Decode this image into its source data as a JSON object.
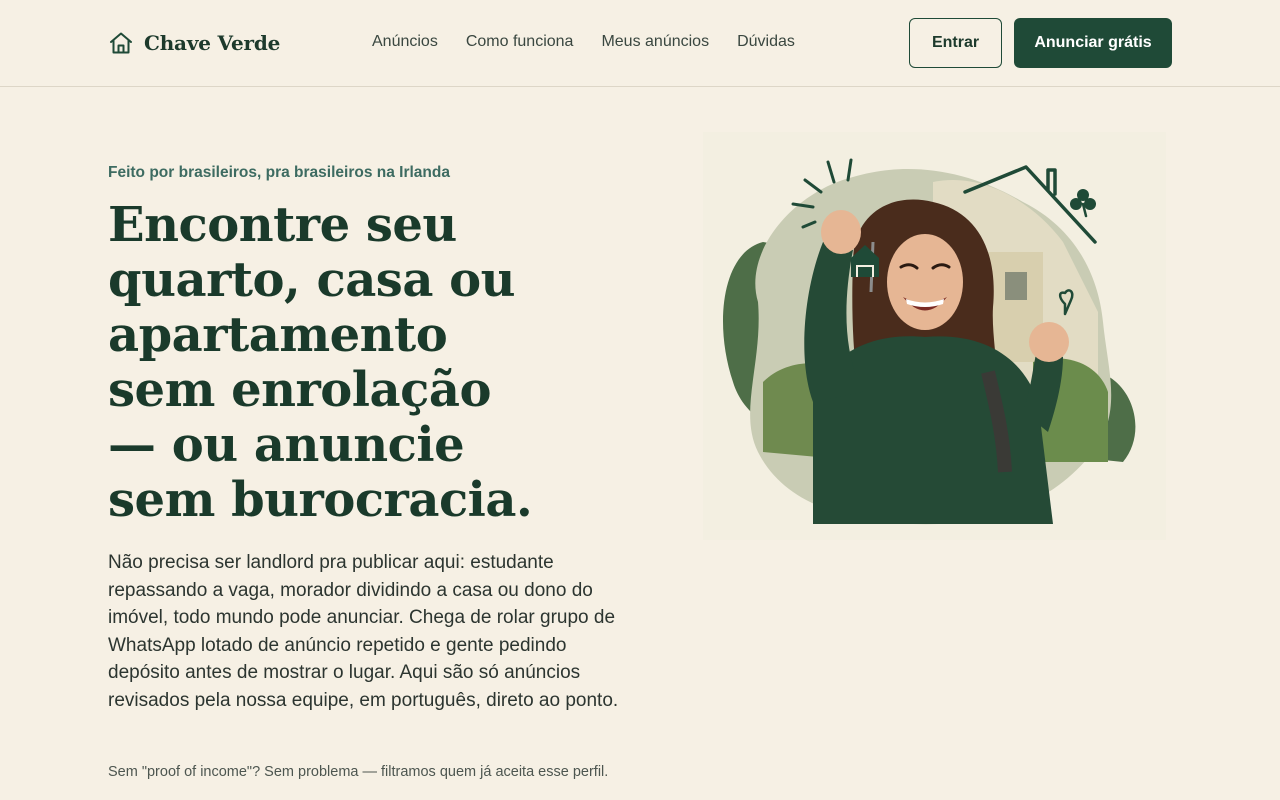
{
  "header": {
    "brand": "Chave Verde",
    "nav": [
      "Anúncios",
      "Como funciona",
      "Meus anúncios",
      "Dúvidas"
    ],
    "login_label": "Entrar",
    "cta_label": "Anunciar grátis"
  },
  "hero": {
    "eyebrow": "Feito por brasileiros, pra brasileiros na Irlanda",
    "headline_lines": [
      "Encontre seu",
      "quarto, casa ou",
      "apartamento",
      "sem enrolação",
      "— ou anuncie",
      "sem burocracia."
    ],
    "lead": "Não precisa ser landlord pra publicar aqui: estudante repassando a vaga, morador dividindo a casa ou dono do imóvel, todo mundo pode anunciar. Chega de rolar grupo de WhatsApp lotado de anúncio repetido e gente pedindo depósito antes de mostrar o lugar. Aqui são só anúncios revisados pela nossa equipe, em português, direto ao ponto.",
    "note": "Sem \"proof of income\"? Sem problema — filtramos quem já aceita esse perfil."
  },
  "colors": {
    "background": "#f6f0e4",
    "brand_green": "#1f4a37",
    "accent_teal": "#3d6b61",
    "headline": "#1a3a2b"
  },
  "icons": [
    "house-icon",
    "key-house-icon",
    "shamrock-icon",
    "heart-icon"
  ]
}
